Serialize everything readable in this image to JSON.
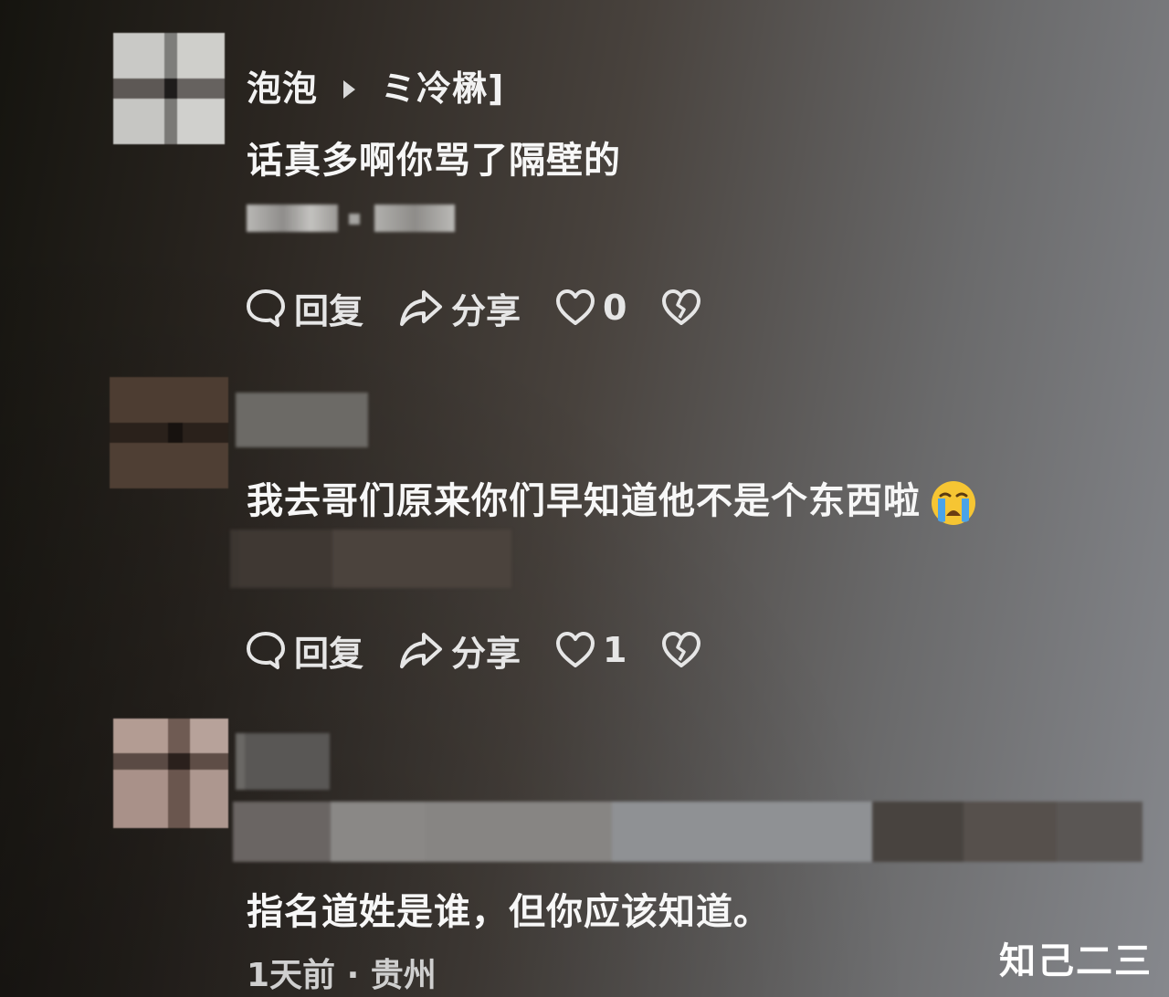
{
  "comments": [
    {
      "username": "泡泡",
      "reply_to": "ミ冷楙]",
      "text": "话真多啊你骂了隔壁的",
      "actions": {
        "reply": "回复",
        "share": "分享",
        "likes": "0"
      }
    },
    {
      "text": "我去哥们原来你们早知道他不是个东西啦",
      "emoji": "loudly-crying-face",
      "actions": {
        "reply": "回复",
        "share": "分享",
        "likes": "1"
      }
    },
    {
      "text": "指名道姓是谁，但你应该知道。",
      "meta": "1天前 · 贵州"
    }
  ],
  "watermark": "知己二三",
  "colors": {
    "text": "#f4f4f4",
    "muted": "#cfcfcf",
    "emoji_yellow": "#f6c533",
    "emoji_tear": "#4aa3e8"
  }
}
